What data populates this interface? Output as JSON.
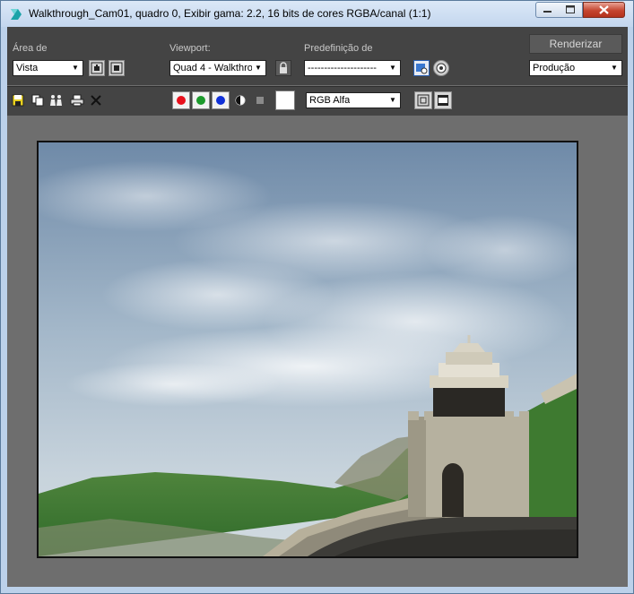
{
  "window": {
    "title": "Walkthrough_Cam01, quadro 0, Exibir gama: 2.2, 16 bits de cores RGBA/canal (1:1)"
  },
  "toolbar": {
    "area_label": "Área de",
    "area_value": "Vista",
    "viewport_label": "Viewport:",
    "viewport_value": "Quad 4 - Walkthro",
    "preset_label": "Predefinição de",
    "preset_value": "---------------------",
    "render_button": "Renderizar",
    "production_value": "Produção",
    "channel_value": "RGB Alfa"
  },
  "colors": {
    "toolbar_bg": "#444444",
    "client_bg": "#6e6e6e",
    "titlebar": "#c3d6ee",
    "red_channel": "#e8101c",
    "green_channel": "#1c9a2c",
    "blue_channel": "#1030d8"
  },
  "icons": [
    "save-icon",
    "copy-icon",
    "clone-window-icon",
    "print-icon",
    "clear-icon",
    "red-channel-icon",
    "green-channel-icon",
    "blue-channel-icon",
    "alpha-channel-icon",
    "monochrome-icon",
    "lock-icon",
    "render-setup-icon",
    "environment-icon"
  ]
}
